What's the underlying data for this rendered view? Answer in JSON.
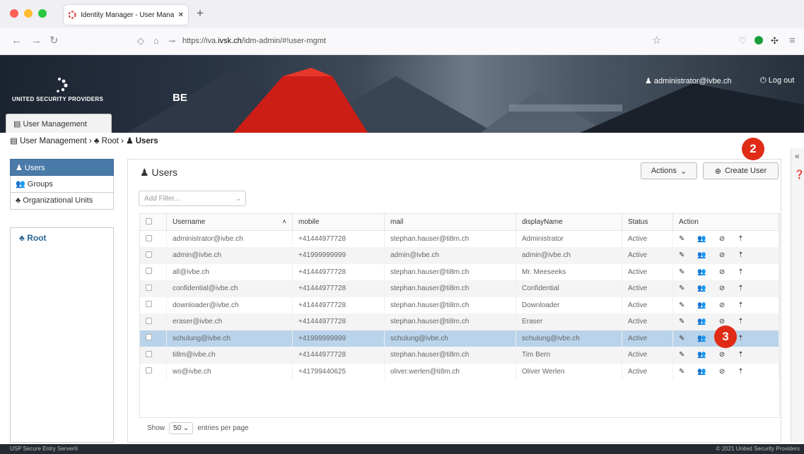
{
  "browser": {
    "tab_title": "Identity Manager - User Manage",
    "url_prefix": "https://iva.",
    "url_domain": "ivsk.ch",
    "url_suffix": "/idm-admin/#!user-mgmt"
  },
  "header": {
    "logo_text": "UNITED SECURITY PROVIDERS",
    "tenant": "BE",
    "user": "administrator@ivbe.ch",
    "logout": "Log out",
    "app_tab": "User Management"
  },
  "breadcrumb": [
    "User Management",
    "Root",
    "Users"
  ],
  "sidebar": {
    "items": [
      "Users",
      "Groups",
      "Organizational Units"
    ],
    "root": "Root"
  },
  "main": {
    "title": "Users",
    "actions_label": "Actions",
    "create_label": "Create User",
    "filter_placeholder": "Add Filter...",
    "columns": [
      "Username",
      "mobile",
      "mail",
      "displayName",
      "Status",
      "Action"
    ],
    "rows": [
      [
        "administrator@ivbe.ch",
        "+41444977728",
        "stephan.hauser@ti8m.ch",
        "Administrator",
        "Active"
      ],
      [
        "admin@ivbe.ch",
        "+41999999999",
        "admin@ivbe.ch",
        "admin@ivbe.ch",
        "Active"
      ],
      [
        "all@ivbe.ch",
        "+41444977728",
        "stephan.hauser@ti8m.ch",
        "Mr. Meeseeks",
        "Active"
      ],
      [
        "confidential@ivbe.ch",
        "+41444977728",
        "stephan.hauser@ti8m.ch",
        "Confidential",
        "Active"
      ],
      [
        "downloader@ivbe.ch",
        "+41444977728",
        "stephan.hauser@ti8m.ch",
        "Downloader",
        "Active"
      ],
      [
        "eraser@ivbe.ch",
        "+41444977728",
        "stephan.hauser@ti8m.ch",
        "Eraser",
        "Active"
      ],
      [
        "schulung@ivbe.ch",
        "+41999999999",
        "schulung@ivbe.ch",
        "schulung@ivbe.ch",
        "Active"
      ],
      [
        "ti8m@ivbe.ch",
        "+41444977728",
        "stephan.hauser@ti8m.ch",
        "Tim Bern",
        "Active"
      ],
      [
        "wo@ivbe.ch",
        "+41799440625",
        "oliver.werlen@ti8m.ch",
        "Oliver Werlen",
        "Active"
      ]
    ],
    "show_label": "Show",
    "page_size": "50",
    "entries_label": "entries per page"
  },
  "footer": {
    "left": "USP Secure Entry Server®",
    "right": "© 2021 United Security Providers"
  },
  "badges": {
    "create": "2",
    "row_action": "3"
  },
  "colors": {
    "accent": "#4a7aa8",
    "badge": "#e02b16",
    "selected_row": "#b9d3ea"
  }
}
